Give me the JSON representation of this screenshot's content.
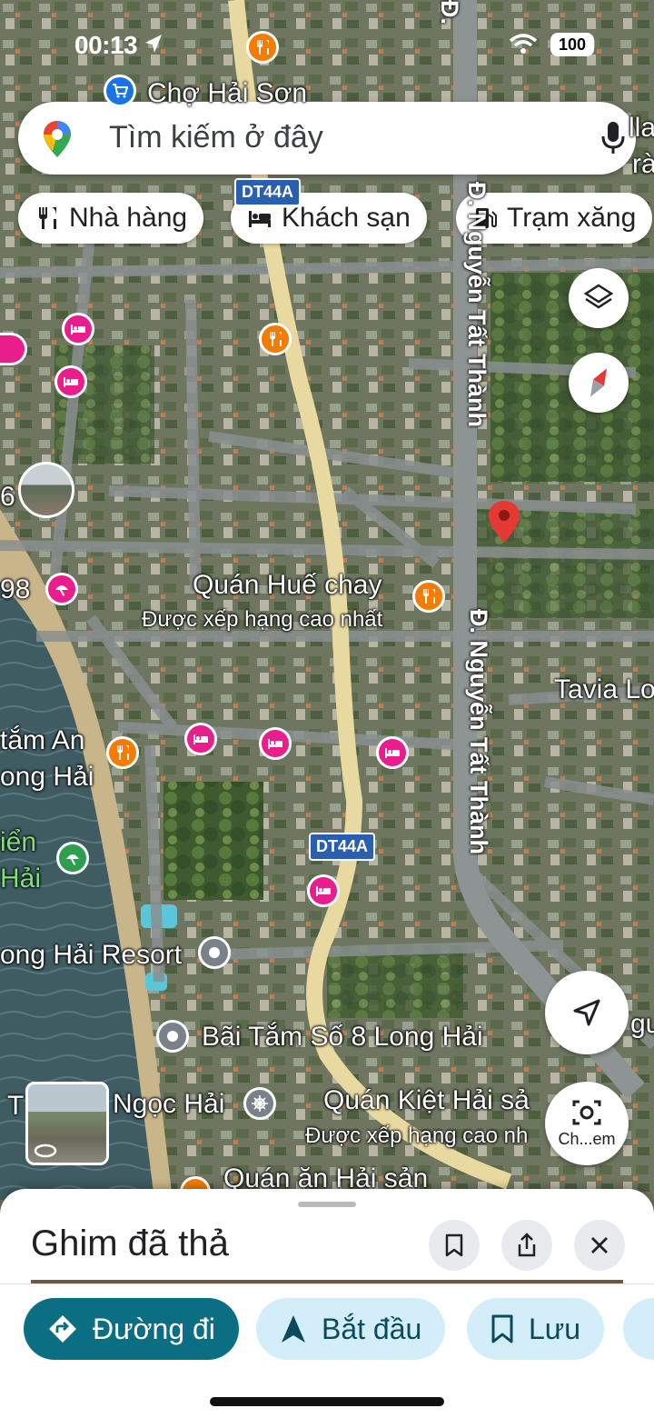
{
  "status": {
    "time": "00:13",
    "battery": "100"
  },
  "search": {
    "placeholder": "Tìm kiếm ở đây"
  },
  "chips": [
    {
      "label": "Nhà hàng",
      "icon": "restaurant-icon"
    },
    {
      "label": "Khách sạn",
      "icon": "hotel-icon"
    },
    {
      "label": "Trạm xăng",
      "icon": "gas-station-icon"
    }
  ],
  "map": {
    "places": {
      "cho_hai_son": "Chợ Hải Sơn",
      "quan_hue_chay": "Quán Huế chay",
      "quan_hue_chay_sub": "Được xếp hạng cao nhất",
      "tavia": "Tavia Lo",
      "tam_an": "tắm An",
      "ong_hai": "ong Hải",
      "bien": "iển",
      "hai": "Hải",
      "resort": "ong Hải Resort",
      "bai_tam": "Bãi Tắm Số 8 Long Hải",
      "t": "T",
      "ngoc_hai": "Ngọc Hải",
      "quan_kiet": "Quán Kiệt Hải sả",
      "quan_kiet_sub": "Được xếp hạng cao nh",
      "quan_an": "Quán ăn Hải sản",
      "num98": "98",
      "num6": "6",
      "alla": "lla",
      "tra": "rà",
      "ngu": "gu"
    },
    "roads": {
      "nguyen_tat_thanh_top": "Đ. Nguyễn Tất Thành",
      "nguyen_tat_thanh_bottom": "Đ. Nguyễn Tất Thành",
      "d_top": "Đ."
    },
    "shields": {
      "top": "DT44A",
      "bottom": "DT44A"
    },
    "streetview_label": "Ch...em",
    "colors": {
      "pin_red": "#e53935",
      "restaurant": "#f57c00",
      "hotel": "#e91e8c",
      "road_yellow": "#e8d9a0"
    }
  },
  "sheet": {
    "title": "Ghim đã thả",
    "buttons": {
      "directions": "Đường đi",
      "start": "Bắt đầu",
      "save": "Lưu"
    }
  }
}
